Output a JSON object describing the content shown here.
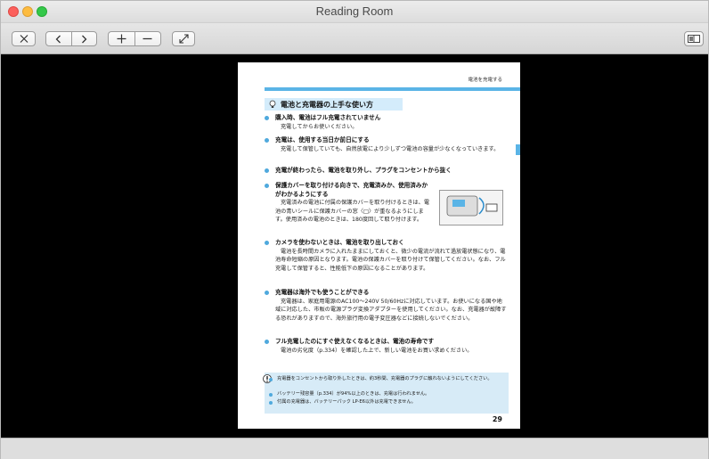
{
  "window": {
    "title": "Reading Room"
  },
  "toolbar": {
    "buttons": [
      {
        "name": "close-book-button",
        "icon": "close-x-icon"
      },
      {
        "name": "previous-page-button",
        "icon": "chevron-left-icon"
      },
      {
        "name": "next-page-button",
        "icon": "chevron-right-icon"
      },
      {
        "name": "zoom-in-button",
        "icon": "plus-icon"
      },
      {
        "name": "zoom-out-button",
        "icon": "minus-icon"
      },
      {
        "name": "fullscreen-button",
        "icon": "expand-arrows-icon"
      },
      {
        "name": "view-mode-button",
        "icon": "two-page-view-icon"
      }
    ]
  },
  "page": {
    "running_head": "電池を充電する",
    "section_title": "電池と充電器の上手な使い方",
    "items": [
      {
        "heading": "購入時、電池はフル充電されていません",
        "body": "充電してからお使いください。"
      },
      {
        "heading": "充電は、使用する当日か前日にする",
        "body": "充電して保管していても、自然放電により少しずつ電池の容量が少なくなっていきます。"
      },
      {
        "heading": "充電が終わったら、電池を取り外し、プラグをコンセントから抜く",
        "body": ""
      },
      {
        "heading": "保護カバーを取り付ける向きで、充電済みか、使用済みかがわかるようにする",
        "body": "充電済みの電池に付属の保護カバーを取り付けるときは、電池の青いシールに保護カバーの窓〈□〉が重なるようにします。使用済みの電池のときは、180度回して取り付けます。"
      },
      {
        "heading": "カメラを使わないときは、電池を取り出しておく",
        "body": "電池を長時間カメラに入れたままにしておくと、微少の電流が流れて過放電状態になり、電池寿命短縮の原因となります。電池の保護カバーを取り付けて保管してください。なお、フル充電して保管すると、性能低下の原因になることがあります。"
      },
      {
        "heading": "充電器は海外でも使うことができる",
        "body": "充電器は、家庭用電源のAC100～240V 50/60Hzに対応しています。お使いになる国や地域に対応した、市販の電源プラグ変換アダプターを使用してください。なお、充電器が故障する恐れがありますので、海外旅行用の電子変圧器などに接続しないでください。"
      },
      {
        "heading": "フル充電したのにすぐ使えなくなるときは、電池の寿命です",
        "body": "電池の劣化度（p.334）を確認した上で、新しい電池をお買い求めください。"
      }
    ],
    "notes": [
      "充電器をコンセントから取り外したときは、約3秒間、充電器のプラグに触れないようにしてください。",
      "バッテリー残容量（p.334）が94%以上のときは、充電は行われません。",
      "付属の充電器は、バッテリーパック LP-E6以外は充電できません。"
    ],
    "page_number": "29"
  }
}
